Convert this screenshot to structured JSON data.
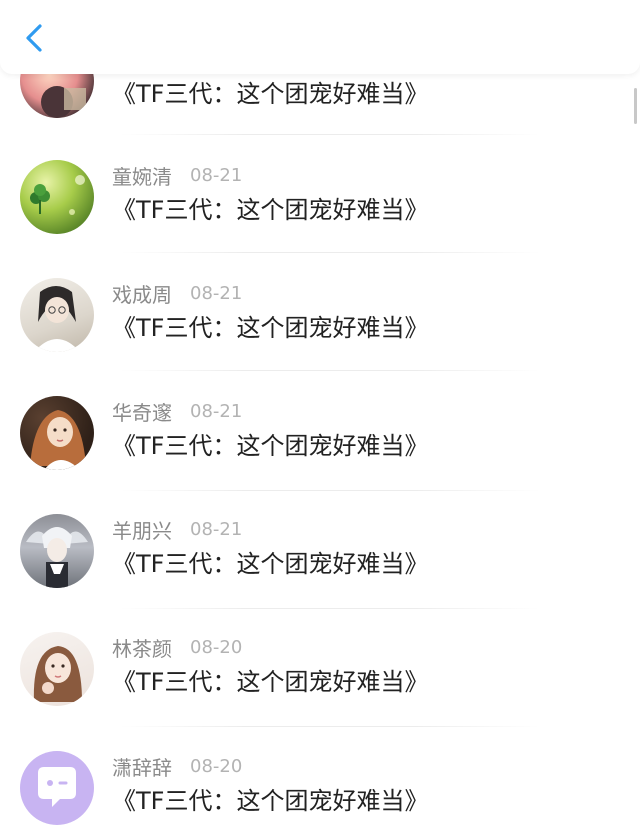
{
  "header": {
    "back_icon": "chevron-left-icon",
    "accent": "#2f9bf0"
  },
  "rows": [
    {
      "name": "",
      "date": "",
      "message": "《TF三代：这个团宠好难当》",
      "avatar": "partial-photo-avatar"
    },
    {
      "name": "童婉清",
      "date": "08-21",
      "message": "《TF三代：这个团宠好难当》",
      "avatar": "clover-photo-avatar"
    },
    {
      "name": "戏成周",
      "date": "08-21",
      "message": "《TF三代：这个团宠好难当》",
      "avatar": "girl-sketch-avatar"
    },
    {
      "name": "华奇邃",
      "date": "08-21",
      "message": "《TF三代：这个团宠好难当》",
      "avatar": "girl-photo-avatar"
    },
    {
      "name": "羊朋兴",
      "date": "08-21",
      "message": "《TF三代：这个团宠好难当》",
      "avatar": "anime-character-avatar"
    },
    {
      "name": "林茶颜",
      "date": "08-20",
      "message": "《TF三代：这个团宠好难当》",
      "avatar": "girl-portrait-avatar"
    },
    {
      "name": "潇辞辞",
      "date": "08-20",
      "message": "《TF三代：这个团宠好难当》",
      "avatar": "chat-bubble-avatar"
    }
  ]
}
